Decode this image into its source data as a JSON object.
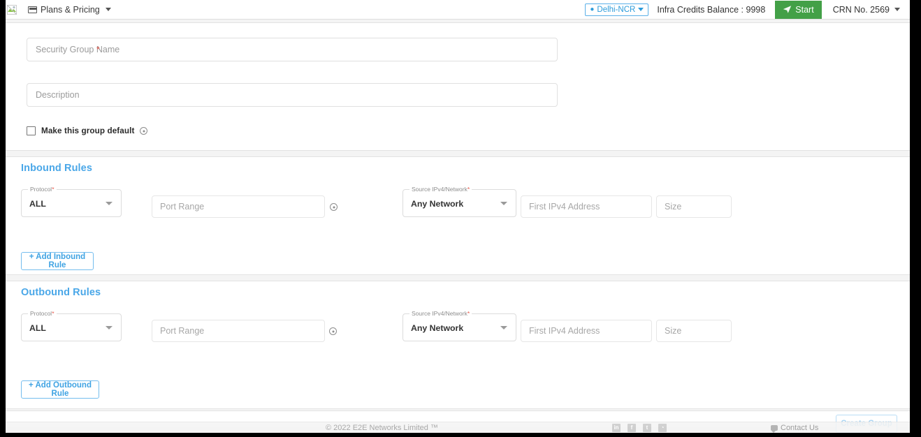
{
  "topbar": {
    "logo_alt": "broken-image-logo",
    "nav": {
      "label": "Plans & Pricing"
    },
    "region": {
      "label": "Delhi-NCR"
    },
    "credits": "Infra Credits Balance : 9998",
    "start_button": "Start",
    "crn": "CRN No. 2569"
  },
  "basic": {
    "name_placeholder": "Security Group Name",
    "name_value": "",
    "name_required_mark": "*",
    "description_placeholder": "Description",
    "description_value": "",
    "default_checkbox_label": "Make this group default",
    "default_checked": false
  },
  "inbound": {
    "title": "Inbound Rules",
    "rules": [
      {
        "protocol_label": "Protocol",
        "protocol_required": "*",
        "protocol_value": "ALL",
        "port_range_placeholder": "Port Range",
        "port_range_value": "",
        "source_label": "Source IPv4/Network",
        "source_required": "*",
        "source_value": "Any Network",
        "first_ip_placeholder": "First IPv4 Address",
        "first_ip_value": "",
        "size_placeholder": "Size",
        "size_value": ""
      }
    ],
    "add_button": "+ Add Inbound Rule"
  },
  "outbound": {
    "title": "Outbound Rules",
    "rules": [
      {
        "protocol_label": "Protocol",
        "protocol_required": "*",
        "protocol_value": "ALL",
        "port_range_placeholder": "Port Range",
        "port_range_value": "",
        "source_label": "Source IPv4/Network",
        "source_required": "*",
        "source_value": "Any Network",
        "first_ip_placeholder": "First IPv4 Address",
        "first_ip_value": "",
        "size_placeholder": "Size",
        "size_value": ""
      }
    ],
    "add_button": "+ Add Outbound Rule"
  },
  "actions": {
    "create_group": "Create Group"
  },
  "footer": {
    "copyright": "© 2022 E2E Networks Limited ™",
    "social": [
      {
        "name": "linkedin-icon",
        "glyph": "in"
      },
      {
        "name": "facebook-icon",
        "glyph": "f"
      },
      {
        "name": "twitter-icon",
        "glyph": "t"
      },
      {
        "name": "rss-icon",
        "glyph": "◔"
      }
    ],
    "contact": "Contact Us"
  },
  "colors": {
    "accent_blue": "#4aa7e8",
    "link_blue": "#2d9cdb",
    "start_green": "#43a047",
    "required_red": "#e8574a",
    "page_bg": "#f4f4f4"
  }
}
